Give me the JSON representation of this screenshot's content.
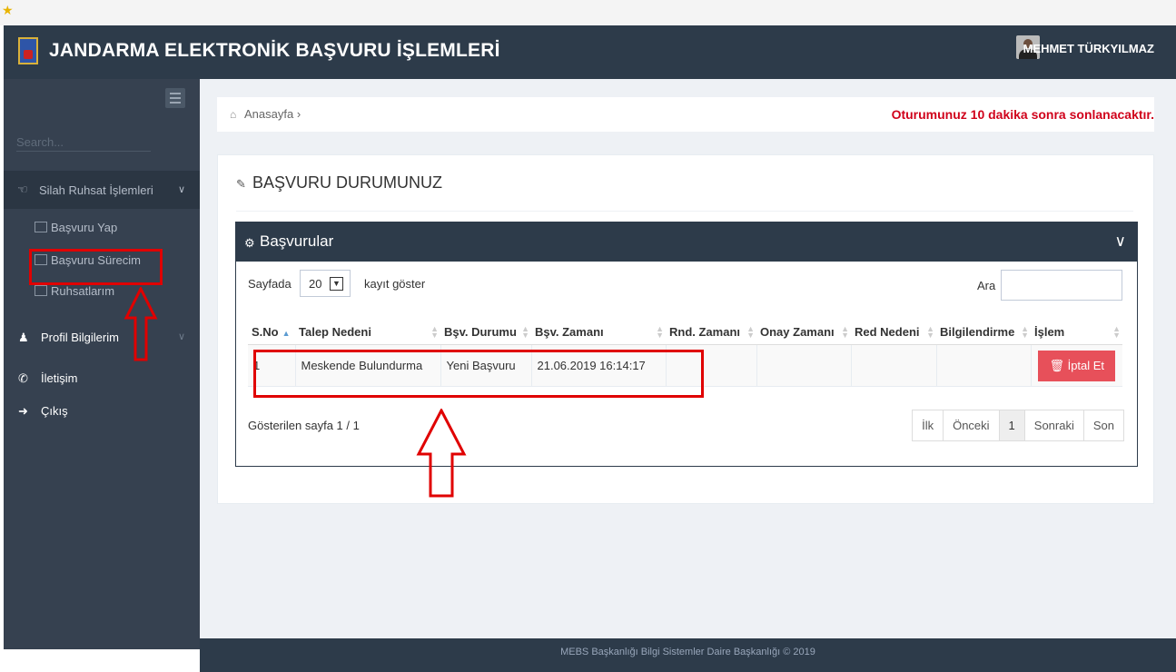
{
  "header": {
    "title": "JANDARMA ELEKTRONİK BAŞVURU İŞLEMLERİ",
    "user": "MEHMET TÜRKYILMAZ"
  },
  "sidebar": {
    "search_placeholder": "Search...",
    "section": "Silah Ruhsat İşlemleri",
    "sub_items": [
      {
        "label": "Başvuru Yap"
      },
      {
        "label": "Başvuru Sürecim"
      },
      {
        "label": "Ruhsatlarım"
      }
    ],
    "items": [
      {
        "label": "Profil Bilgilerim"
      },
      {
        "label": "İletişim"
      },
      {
        "label": "Çıkış"
      }
    ]
  },
  "breadcrumb": {
    "home": "Anasayfa",
    "separator": "›",
    "warning": "Oturumunuz 10 dakika sonra sonlanacaktır."
  },
  "page": {
    "title": "BAŞVURU DURUMUNUZ"
  },
  "box": {
    "title": "Başvurular",
    "length_label_pre": "Sayfada",
    "length_value": "20",
    "length_label_post": "kayıt göster",
    "search_label": "Ara",
    "columns": [
      "S.No",
      "Talep Nedeni",
      "Bşv. Durumu",
      "Bşv. Zamanı",
      "Rnd. Zamanı",
      "Onay Zamanı",
      "Red Nedeni",
      "Bilgilendirme",
      "İşlem"
    ],
    "rows": [
      {
        "sno": "1",
        "talep": "Meskende Bulundurma",
        "durum": "Yeni Başvuru",
        "zaman": "21.06.2019 16:14:17",
        "rnd": "",
        "onay": "",
        "red": "",
        "bilgi": "",
        "action": "İptal Et"
      }
    ],
    "info": "Gösterilen sayfa 1 / 1",
    "pager": [
      "İlk",
      "Önceki",
      "1",
      "Sonraki",
      "Son"
    ]
  },
  "footer": "MEBS Başkanlığı Bilgi Sistemler Daire Başkanlığı © 2019",
  "colors": {
    "header": "#2d3b4a",
    "sidebar": "#364150",
    "annotation": "#e00000",
    "danger": "#e7505a"
  }
}
